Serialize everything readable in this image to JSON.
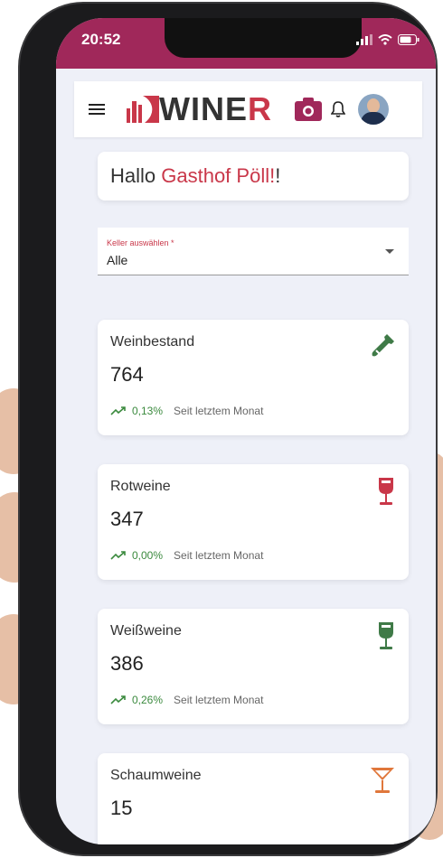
{
  "status_bar": {
    "time": "20:52"
  },
  "app_bar": {
    "logo_main": "WINE",
    "logo_accent": "R"
  },
  "greeting": {
    "prefix": "Hallo ",
    "name": "Gasthof Pöll!",
    "suffix": "!"
  },
  "cellar_select": {
    "label": "Keller auswählen *",
    "value": "Alle"
  },
  "stats": [
    {
      "title": "Weinbestand",
      "value": "764",
      "change": "0,13%",
      "note": "Seit letztem Monat",
      "icon": "wine-bottle-icon",
      "icon_color": "#3f7a47"
    },
    {
      "title": "Rotweine",
      "value": "347",
      "change": "0,00%",
      "note": "Seit letztem Monat",
      "icon": "wine-glass-icon",
      "icon_color": "#c93749"
    },
    {
      "title": "Weißweine",
      "value": "386",
      "change": "0,26%",
      "note": "Seit letztem Monat",
      "icon": "wine-glass-icon",
      "icon_color": "#3f7a47"
    },
    {
      "title": "Schaumweine",
      "value": "15",
      "icon": "cocktail-glass-icon",
      "icon_color": "#e0773b"
    }
  ],
  "colors": {
    "brand": "#a0285a",
    "accent": "#c93749",
    "positive": "#3b8a3e"
  }
}
